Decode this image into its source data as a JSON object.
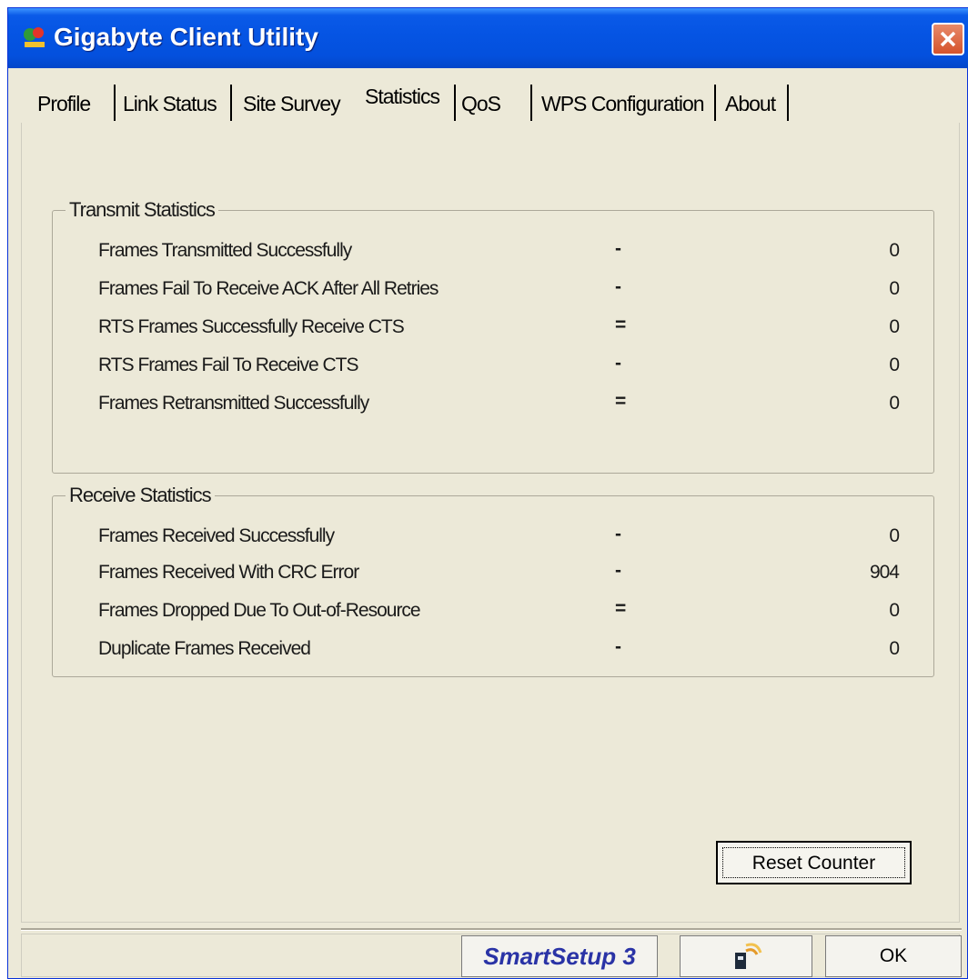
{
  "window": {
    "title": "Gigabyte Client Utility"
  },
  "tabs": [
    {
      "label": "Profile"
    },
    {
      "label": "Link Status"
    },
    {
      "label": "Site Survey"
    },
    {
      "label": "Statistics",
      "active": true
    },
    {
      "label": "QoS"
    },
    {
      "label": "WPS Configuration"
    },
    {
      "label": "About"
    }
  ],
  "transmit": {
    "title": "Transmit Statistics",
    "rows": [
      {
        "label": "Frames Transmitted Successfully",
        "sep": "-",
        "value": "0"
      },
      {
        "label": "Frames Fail To Receive ACK After All Retries",
        "sep": "-",
        "value": "0"
      },
      {
        "label": "RTS Frames Successfully Receive CTS",
        "sep": "=",
        "value": "0"
      },
      {
        "label": "RTS Frames Fail To Receive CTS",
        "sep": "-",
        "value": "0"
      },
      {
        "label": "Frames Retransmitted Successfully",
        "sep": "=",
        "value": "0"
      }
    ]
  },
  "receive": {
    "title": "Receive Statistics",
    "rows": [
      {
        "label": "Frames Received Successfully",
        "sep": "-",
        "value": "0"
      },
      {
        "label": "Frames Received With CRC Error",
        "sep": "-",
        "value": "904"
      },
      {
        "label": "Frames Dropped Due To Out-of-Resource",
        "sep": "=",
        "value": "0"
      },
      {
        "label": "Duplicate Frames Received",
        "sep": "-",
        "value": "0"
      }
    ]
  },
  "buttons": {
    "reset": "Reset Counter",
    "smartsetup": "SmartSetup 3",
    "ok": "OK"
  },
  "colors": {
    "titlebar": "#0554e3",
    "background": "#ece9d8",
    "smartsetup_text": "#2a33a6"
  }
}
